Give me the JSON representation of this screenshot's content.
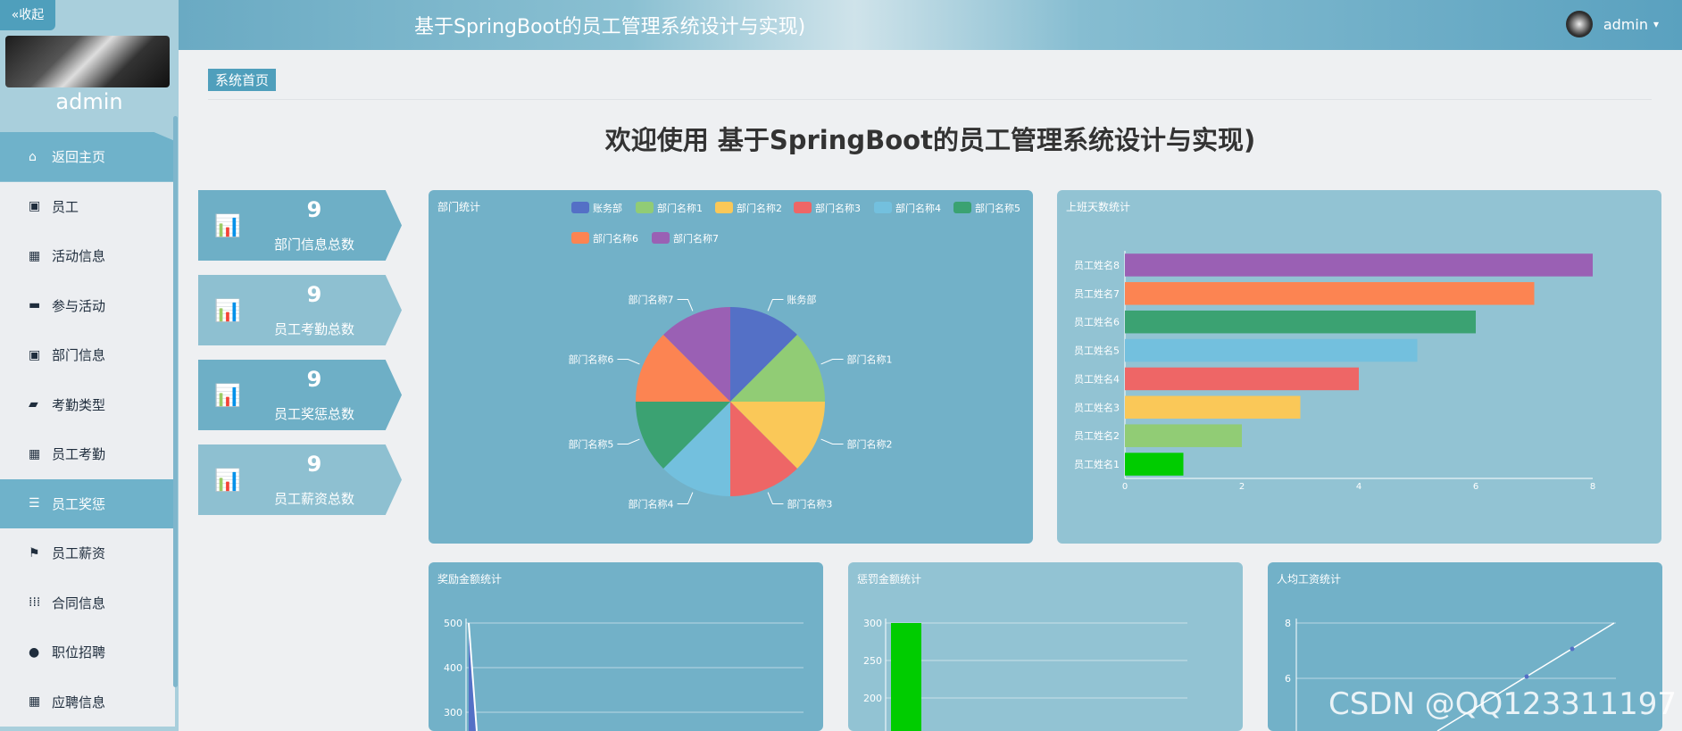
{
  "sidebar": {
    "collapse_label": "«收起",
    "username": "admin",
    "items": [
      {
        "label": "返回主页",
        "icon": "home-icon"
      },
      {
        "label": "员工",
        "icon": "clipboard-icon"
      },
      {
        "label": "活动信息",
        "icon": "grid-icon"
      },
      {
        "label": "参与活动",
        "icon": "monitor-icon"
      },
      {
        "label": "部门信息",
        "icon": "clipboard-icon"
      },
      {
        "label": "考勤类型",
        "icon": "thumb-icon"
      },
      {
        "label": "员工考勤",
        "icon": "grid-icon"
      },
      {
        "label": "员工奖惩",
        "icon": "sliders-icon"
      },
      {
        "label": "员工薪资",
        "icon": "flag-icon"
      },
      {
        "label": "合同信息",
        "icon": "apps-icon"
      },
      {
        "label": "职位招聘",
        "icon": "user-icon"
      },
      {
        "label": "应聘信息",
        "icon": "grid-icon"
      }
    ]
  },
  "header": {
    "title": "基于SpringBoot的员工管理系统设计与实现)",
    "user": "admin"
  },
  "breadcrumb": "系统首页",
  "welcome": "欢迎使用 基于SpringBoot的员工管理系统设计与实现)",
  "stats": [
    {
      "value": "9",
      "label": "部门信息总数"
    },
    {
      "value": "9",
      "label": "员工考勤总数"
    },
    {
      "value": "9",
      "label": "员工奖惩总数"
    },
    {
      "value": "9",
      "label": "员工薪资总数"
    }
  ],
  "colors": {
    "accent": "#4f9fbc",
    "card": "#72b1c8"
  },
  "watermark": "CSDN @QQ123311197",
  "chart_data": [
    {
      "type": "pie",
      "title": "部门统计",
      "categories": [
        "账务部",
        "部门名称1",
        "部门名称2",
        "部门名称3",
        "部门名称4",
        "部门名称5",
        "部门名称6",
        "部门名称7"
      ],
      "values": [
        1,
        1,
        1,
        1,
        1,
        1,
        1,
        1
      ],
      "colors": [
        "#5470c6",
        "#91cc75",
        "#fac858",
        "#ee6666",
        "#73c0de",
        "#3ba272",
        "#fc8452",
        "#9a60b4"
      ],
      "legend": "top"
    },
    {
      "type": "bar",
      "title": "上班天数统计",
      "categories": [
        "员工姓名1",
        "员工姓名2",
        "员工姓名3",
        "员工姓名4",
        "员工姓名5",
        "员工姓名6",
        "员工姓名7",
        "员工姓名8"
      ],
      "values": [
        1,
        2,
        3,
        4,
        5,
        6,
        7,
        8
      ],
      "colors": [
        "#00cc00",
        "#91cc75",
        "#fac858",
        "#ee6666",
        "#73c0de",
        "#3ba272",
        "#fc8452",
        "#9a60b4"
      ],
      "xticks": [
        "0",
        "2",
        "4",
        "6",
        "8"
      ],
      "xlim": [
        0,
        8
      ],
      "orientation": "horizontal"
    },
    {
      "type": "area",
      "title": "奖励金额统计",
      "yticks": [
        "500",
        "400",
        "300"
      ],
      "ylim": [
        300,
        500
      ]
    },
    {
      "type": "bar",
      "title": "惩罚金额统计",
      "values": [
        300
      ],
      "yticks": [
        "300",
        "250",
        "200"
      ],
      "ylim": [
        200,
        300
      ],
      "colors": [
        "#00cc00"
      ]
    },
    {
      "type": "line",
      "title": "人均工资统计",
      "yticks": [
        "8",
        "6"
      ],
      "ylim": [
        6,
        8
      ]
    }
  ]
}
